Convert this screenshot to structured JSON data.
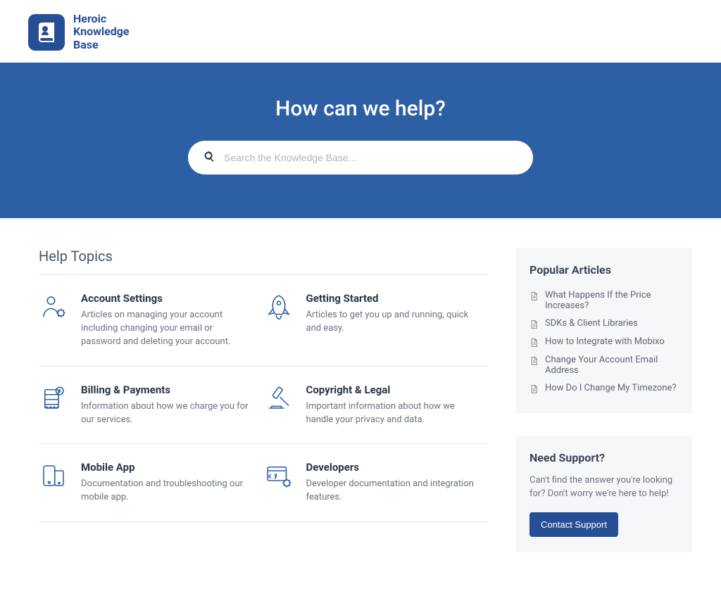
{
  "logo": {
    "line1": "Heroic",
    "line2": "Knowledge",
    "line3": "Base"
  },
  "hero": {
    "title": "How can we help?",
    "search_placeholder": "Search the Knowledge Base..."
  },
  "topics_heading": "Help Topics",
  "topics": [
    {
      "title": "Account Settings",
      "desc": "Articles on managing your account including changing your email or password and deleting your account."
    },
    {
      "title": "Getting Started",
      "desc": "Articles to get you up and running, quick and easy."
    },
    {
      "title": "Billing & Payments",
      "desc": "Information about how we charge you for our services."
    },
    {
      "title": "Copyright & Legal",
      "desc": "Important information about how we handle your privacy and data."
    },
    {
      "title": "Mobile App",
      "desc": "Documentation and troubleshooting our mobile app."
    },
    {
      "title": "Developers",
      "desc": "Developer documentation and integration features."
    }
  ],
  "popular": {
    "heading": "Popular Articles",
    "items": [
      "What Happens If the Price Increases?",
      "SDKs & Client Libraries",
      "How to Integrate with Mobixo",
      "Change Your Account Email Address",
      "How Do I Change My Timezone?"
    ]
  },
  "support": {
    "heading": "Need Support?",
    "text": "Can't find the answer you're looking for? Don't worry we're here to help!",
    "button": "Contact Support"
  }
}
